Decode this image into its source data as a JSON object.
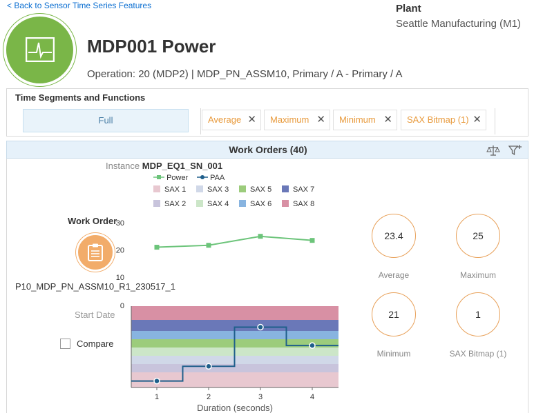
{
  "nav": {
    "back_label": "< Back to Sensor Time Series Features"
  },
  "plant": {
    "label": "Plant",
    "value": "Seattle Manufacturing (M1)"
  },
  "header": {
    "title": "MDP001 Power",
    "subtitle": "Operation: 20 (MDP2) | MDP_PN_ASSM10, Primary / A - Primary / A"
  },
  "segments": {
    "title": "Time Segments and Functions",
    "full_label": "Full",
    "functions": [
      "Average",
      "Maximum",
      "Minimum",
      "SAX Bitmap (1)"
    ]
  },
  "work_orders": {
    "title": "Work Orders (40)",
    "instance_label": "Instance",
    "instance_value": "MDP_EQ1_SN_001",
    "legend": {
      "series": [
        {
          "name": "Power",
          "color": "#6cc47a",
          "marker": "square"
        },
        {
          "name": "PAA",
          "color": "#1f5f8b",
          "marker": "circle"
        }
      ],
      "bands": [
        {
          "name": "SAX 1",
          "color": "#e8c8d0"
        },
        {
          "name": "SAX 3",
          "color": "#d0d8e8"
        },
        {
          "name": "SAX 5",
          "color": "#9ccc7c"
        },
        {
          "name": "SAX 7",
          "color": "#6a78b8"
        },
        {
          "name": "SAX 2",
          "color": "#c8c4dc"
        },
        {
          "name": "SAX 4",
          "color": "#cce6c8"
        },
        {
          "name": "SAX 6",
          "color": "#88b4e0"
        },
        {
          "name": "SAX 8",
          "color": "#d890a4"
        }
      ]
    },
    "work_order_label": "Work Order",
    "work_order_id": "P10_MDP_PN_ASSM10_R1_230517_1",
    "start_date_label": "Start Date",
    "compare_label": "Compare",
    "x_axis_label": "Duration (seconds)"
  },
  "kpis": [
    {
      "value": "23.4",
      "label": "Average"
    },
    {
      "value": "25",
      "label": "Maximum"
    },
    {
      "value": "21",
      "label": "Minimum"
    },
    {
      "value": "1",
      "label": "SAX Bitmap (1)"
    }
  ],
  "colors": {
    "accent_green": "#7ab648",
    "accent_orange": "#f2ac6a",
    "token_text": "#e89a3c",
    "link": "#0a6ed1"
  },
  "chart_data": [
    {
      "type": "line",
      "series": [
        {
          "name": "Power",
          "x": [
            1,
            2,
            3,
            4
          ],
          "values": [
            21,
            21.7,
            25,
            23.5
          ]
        }
      ],
      "yticks": [
        10,
        20,
        30
      ],
      "ylim": [
        10,
        30
      ]
    },
    {
      "type": "line",
      "series": [
        {
          "name": "PAA",
          "x": [
            1,
            2,
            3,
            4
          ],
          "values": [
            -1.2,
            -0.6,
            1.0,
            0.25
          ]
        }
      ],
      "xticks": [
        1,
        2,
        3,
        4
      ],
      "y_top_tick": "0",
      "xlabel": "Duration (seconds)"
    }
  ]
}
